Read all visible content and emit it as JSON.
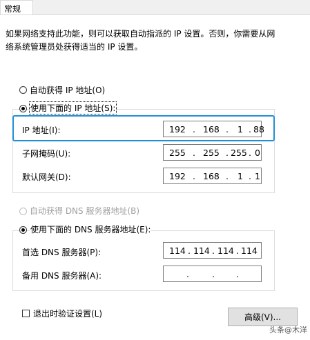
{
  "tab": {
    "label": "常规"
  },
  "description": {
    "line1": "如果网络支持此功能，则可以获取自动指派的 IP 设置。否则，你需要从网",
    "line2": "络系统管理员处获得适当的 IP 设置。"
  },
  "ip_section": {
    "auto_radio_label": "自动获得 IP 地址(O)",
    "manual_radio_label": "使用下面的 IP 地址(S):",
    "selected": "manual",
    "fields": [
      {
        "label": "IP 地址(I):",
        "octets": [
          "192",
          "168",
          "1",
          "88"
        ]
      },
      {
        "label": "子网掩码(U):",
        "octets": [
          "255",
          "255",
          "255",
          "0"
        ]
      },
      {
        "label": "默认网关(D):",
        "octets": [
          "192",
          "168",
          "1",
          "1"
        ]
      }
    ]
  },
  "dns_section": {
    "auto_radio_label": "自动获得 DNS 服务器地址(B)",
    "auto_radio_enabled": false,
    "manual_radio_label": "使用下面的 DNS 服务器地址(E):",
    "selected": "manual",
    "fields": [
      {
        "label": "首选 DNS 服务器(P):",
        "octets": [
          "114",
          "114",
          "114",
          "114"
        ]
      },
      {
        "label": "备用 DNS 服务器(A):",
        "octets": [
          "",
          "",
          "",
          ""
        ]
      }
    ]
  },
  "validate_on_exit": {
    "label": "退出时验证设置(L)",
    "checked": false
  },
  "advanced_button": {
    "label": "高级(V)..."
  },
  "watermark": {
    "text": "头条@木洋"
  },
  "colors": {
    "highlight": "#1e90d6",
    "button_bg": "#e1e1e1"
  }
}
